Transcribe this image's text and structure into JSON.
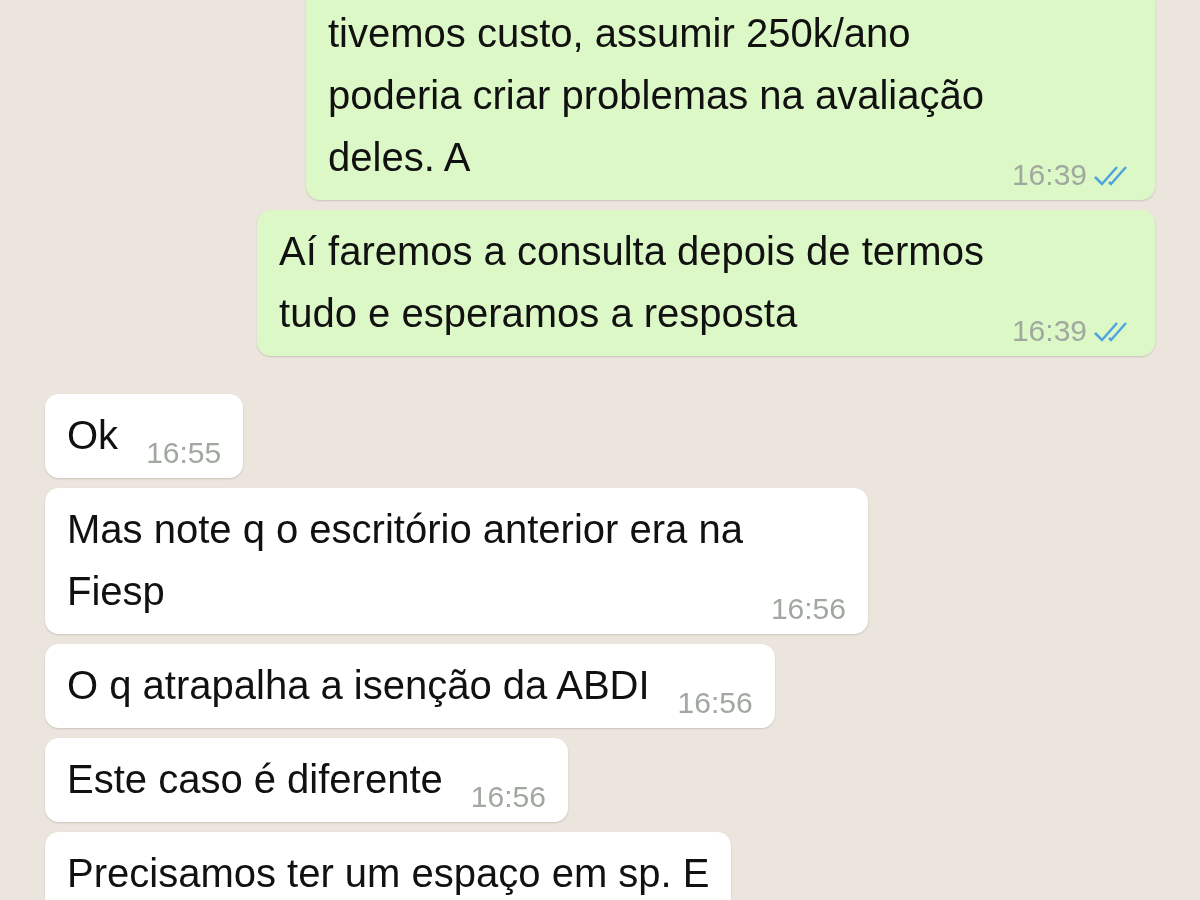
{
  "messages": [
    {
      "outgoing": true,
      "text": "tivemos custo, assumir 250k/ano\npoderia criar problemas na avaliação\ndeles. A",
      "time": "16:39",
      "read": true
    },
    {
      "outgoing": true,
      "text": "Aí faremos a consulta depois de termos\ntudo e esperamos a resposta",
      "time": "16:39",
      "read": true
    },
    {
      "outgoing": false,
      "text": "Ok",
      "time": "16:55"
    },
    {
      "outgoing": false,
      "text": "Mas note q o escritório anterior era na\nFiesp",
      "time": "16:56"
    },
    {
      "outgoing": false,
      "text": "O q atrapalha a isenção da ABDI",
      "time": "16:56"
    },
    {
      "outgoing": false,
      "text": "Este caso é diferente",
      "time": "16:56"
    },
    {
      "outgoing": false,
      "text": "Precisamos ter um espaço em sp. E"
    }
  ]
}
